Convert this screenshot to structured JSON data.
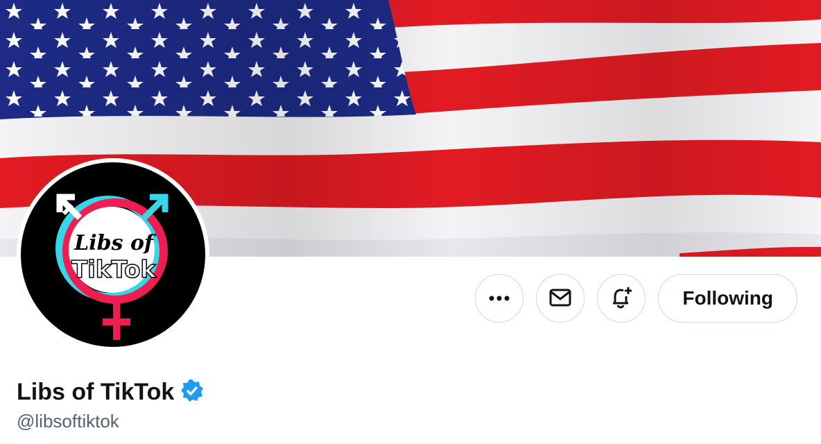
{
  "profile": {
    "display_name": "Libs of TikTok",
    "handle": "@libsoftiktok",
    "avatar_text_line1": "Libs of",
    "avatar_text_line2": "TikTok",
    "verified": true
  },
  "actions": {
    "more_icon": "more-dots-icon",
    "message_icon": "envelope-icon",
    "notify_icon": "bell-plus-icon",
    "follow_label": "Following"
  },
  "colors": {
    "flag_red": "#e21b23",
    "flag_blue": "#1d2b86",
    "verified_blue": "#1d9bf0",
    "avatar_pink": "#ee1d52",
    "avatar_cyan": "#38d6e6",
    "handle_gray": "#536471"
  }
}
